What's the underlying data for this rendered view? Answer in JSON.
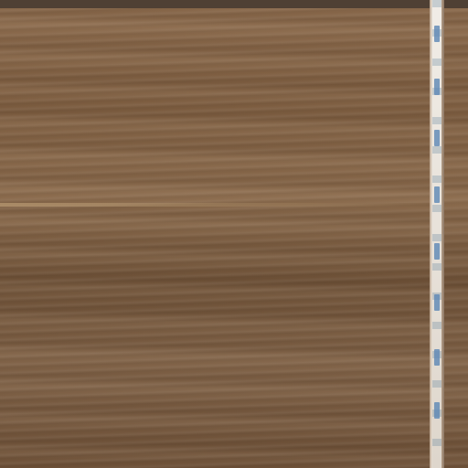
{
  "app": {
    "title": ""
  },
  "colors": {
    "top_bar": "#4f4034",
    "wood_base": "#7a5b40",
    "divider_light": "#eae2d8",
    "divider_accent": "#5d87b5"
  },
  "scene": {
    "description_label": ""
  }
}
